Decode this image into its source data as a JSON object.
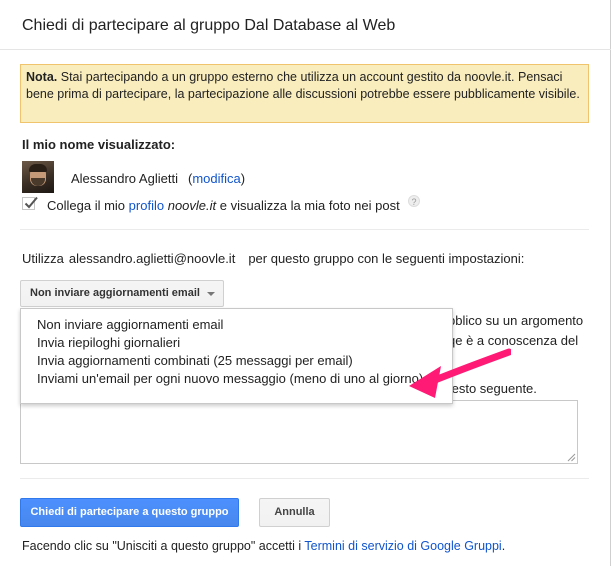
{
  "dialog": {
    "title": "Chiedi di partecipare al gruppo Dal Database al Web"
  },
  "notice": {
    "bold": "Nota.",
    "text": "Stai partecipando a un gruppo esterno che utilizza un account gestito da noovle.it. Pensaci bene prima di partecipare, la partecipazione alle discussioni potrebbe essere pubblicamente visibile."
  },
  "display_name": {
    "heading": "Il mio nome visualizzato:",
    "user_name": "Alessandro Aglietti",
    "modify_open": "(",
    "modify_label": "modifica",
    "modify_close": ")",
    "checkbox_checked": true,
    "check_text_1": "Collega il mio",
    "profile_link": "profilo",
    "profile_domain": "noovle.it",
    "check_text_2": "e visualizza la mia foto nei post",
    "help_icon": "?"
  },
  "subscription": {
    "use_label": "Utilizza",
    "email": "alessandro.aglietti@noovle.it",
    "use_suffix": "per questo gruppo con le seguenti impostazioni:",
    "selected": "Non inviare aggiornamenti email",
    "options": [
      "Non inviare aggiornamenti email",
      "Invia riepiloghi giornalieri",
      "Invia aggiornamenti combinati (25 messaggi per email)",
      "Inviami un'email per ogni nuovo messaggio (meno di uno al giorno)"
    ],
    "partial_1": "bblico su un argomento",
    "partial_2": "qe è a conoscenza del",
    "partial_3": "testo seguente."
  },
  "message": {
    "value": ""
  },
  "buttons": {
    "join": "Chiedi di partecipare a questo gruppo",
    "cancel": "Annulla"
  },
  "footer": {
    "text": "Facendo clic su \"Unisciti a questo gruppo\" accetti i",
    "terms_link": "Termini di servizio di Google Gruppi",
    "period": "."
  },
  "colors": {
    "link": "#1155cc",
    "primary_button": "#4d90fe",
    "notice_bg": "#f9edbe",
    "pointer": "#ff1a75"
  }
}
